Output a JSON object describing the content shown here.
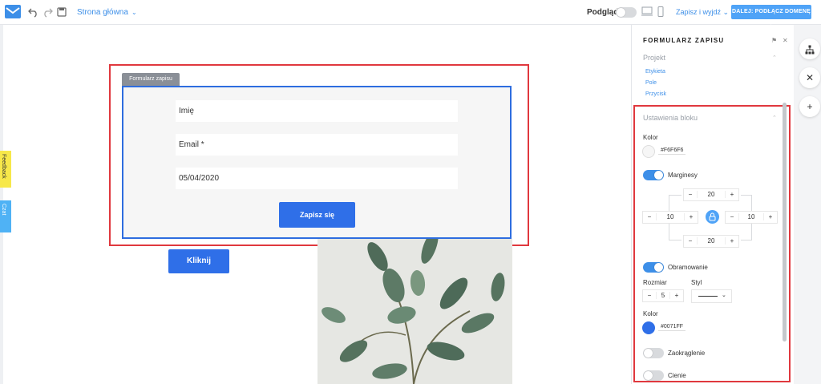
{
  "topbar": {
    "page_name": "Strona główna",
    "preview_label": "Podgląd",
    "save_exit_label": "Zapisz i wyjdź",
    "next_button_label": "DALEJ: PODŁĄCZ DOMENĘ"
  },
  "side_tabs": {
    "feedback_label": "Feedback",
    "chat_label": "Czat"
  },
  "canvas": {
    "form_tag_label": "Formularz zapisu",
    "fields": [
      {
        "label": "Imię"
      },
      {
        "label": "Email *"
      },
      {
        "label": "05/04/2020"
      }
    ],
    "submit_label": "Zapisz się",
    "click_label": "Kliknij"
  },
  "panel": {
    "title": "FORMULARZ ZAPISU",
    "project_section": "Projekt",
    "project_links": [
      "Etykieta",
      "Pole",
      "Przycisk"
    ],
    "block_settings_section": "Ustawienia bloku",
    "color_label": "Kolor",
    "bg_color": "#F6F6F6",
    "margins_label": "Marginesy",
    "margins_enabled": true,
    "margin_top": "20",
    "margin_left": "10",
    "margin_right": "10",
    "margin_bottom": "20",
    "border_label": "Obramowanie",
    "border_enabled": true,
    "size_label": "Rozmiar",
    "size_value": "5",
    "style_label": "Styl",
    "border_color_label": "Kolor",
    "border_color": "#0071FF",
    "rounding_label": "Zaokrąglenie",
    "rounding_enabled": false,
    "shadows_label": "Cienie",
    "shadows_enabled": false
  },
  "colors": {
    "accent": "#3d8fe8",
    "form_bg": "#f6f6f6",
    "border_swatch": "#2f6fe8",
    "highlight_red": "#e0383e",
    "highlight_blue": "#2e6ddf"
  }
}
